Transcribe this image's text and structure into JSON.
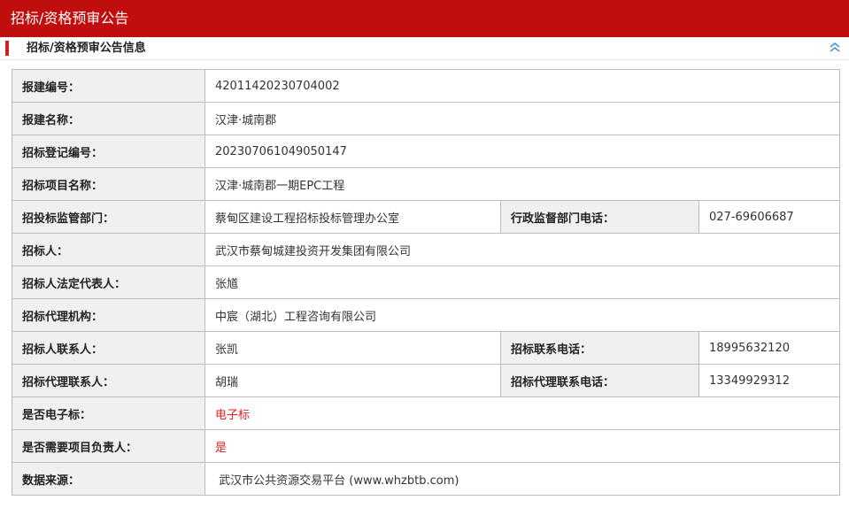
{
  "header": {
    "title": "招标/资格预审公告"
  },
  "section": {
    "title": "招标/资格预审公告信息",
    "collapse_icon": "double-chevron-up-icon"
  },
  "colors": {
    "brand_red": "#c00d0d",
    "accent_red": "#e02020",
    "label_bg": "#f0f0f0"
  },
  "rows": [
    {
      "label": "报建编号：",
      "value": "42011420230704002"
    },
    {
      "label": "报建名称：",
      "value": "汉津·城南郡"
    },
    {
      "label": "招标登记编号：",
      "value": "202307061049050147"
    },
    {
      "label": "招标项目名称：",
      "value": "汉津·城南郡一期EPC工程"
    },
    {
      "label": "招投标监管部门：",
      "value": "蔡甸区建设工程招标投标管理办公室",
      "label2": "行政监督部门电话：",
      "value2": "027-69606687"
    },
    {
      "label": "招标人：",
      "value": "武汉市蔡甸城建投资开发集团有限公司"
    },
    {
      "label": "招标人法定代表人：",
      "value": "张馗"
    },
    {
      "label": "招标代理机构：",
      "value": "中宸（湖北）工程咨询有限公司"
    },
    {
      "label": "招标人联系人：",
      "value": "张凯",
      "label2": "招标联系电话：",
      "value2": "18995632120"
    },
    {
      "label": "招标代理联系人：",
      "value": "胡瑞",
      "label2": "招标代理联系电话：",
      "value2": "13349929312"
    },
    {
      "label": "是否电子标：",
      "value": "电子标"
    },
    {
      "label": "是否需要项目负责人：",
      "value": "是"
    },
    {
      "label": "数据来源：",
      "value": " 武汉市公共资源交易平台 (www.whzbtb.com)"
    }
  ]
}
